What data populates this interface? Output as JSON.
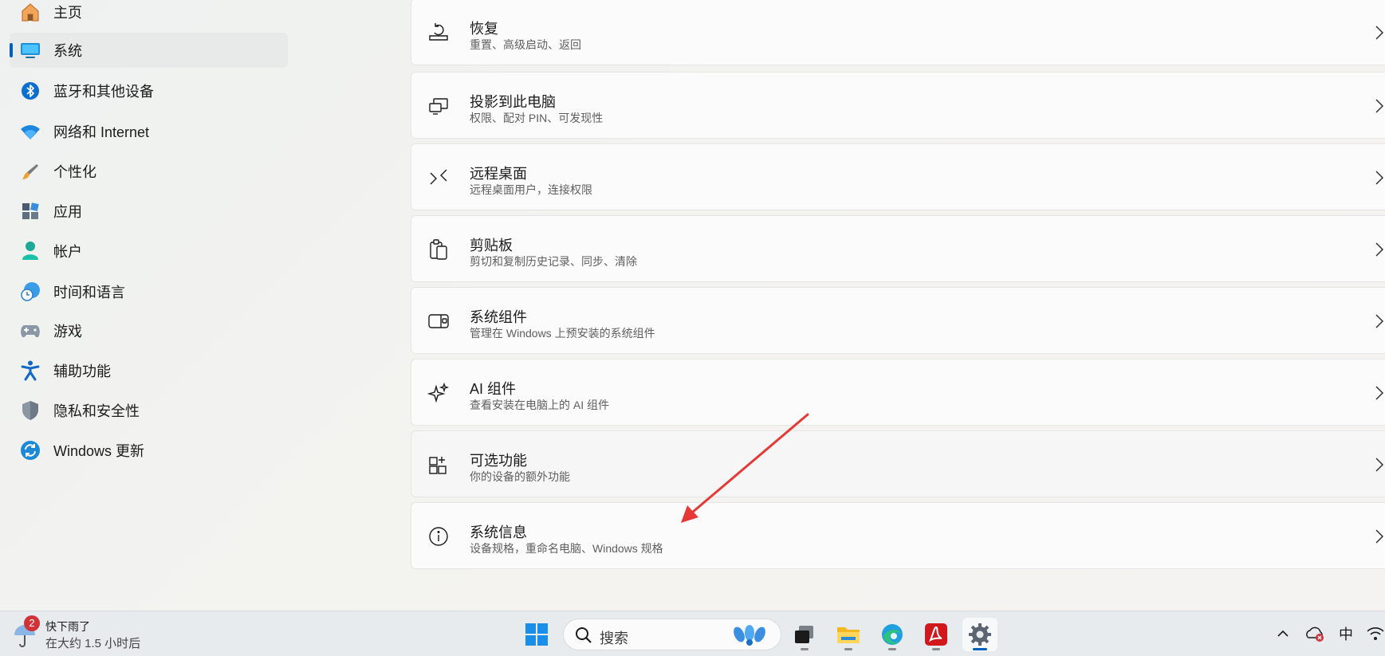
{
  "sidebar": {
    "items": [
      {
        "label": "主页",
        "icon": "home-icon"
      },
      {
        "label": "系统",
        "icon": "system-icon",
        "selected": true
      },
      {
        "label": "蓝牙和其他设备",
        "icon": "bluetooth-icon"
      },
      {
        "label": "网络和 Internet",
        "icon": "wifi-icon"
      },
      {
        "label": "个性化",
        "icon": "brush-icon"
      },
      {
        "label": "应用",
        "icon": "apps-icon"
      },
      {
        "label": "帐户",
        "icon": "account-icon"
      },
      {
        "label": "时间和语言",
        "icon": "globe-clock-icon"
      },
      {
        "label": "游戏",
        "icon": "gamepad-icon"
      },
      {
        "label": "辅助功能",
        "icon": "accessibility-icon"
      },
      {
        "label": "隐私和安全性",
        "icon": "shield-icon"
      },
      {
        "label": "Windows 更新",
        "icon": "update-icon"
      }
    ]
  },
  "settings": {
    "cards": [
      {
        "title": "恢复",
        "description": "重置、高级启动、返回",
        "icon": "recovery-icon"
      },
      {
        "title": "投影到此电脑",
        "description": "权限、配对 PIN、可发现性",
        "icon": "projection-icon"
      },
      {
        "title": "远程桌面",
        "description": "远程桌面用户，连接权限",
        "icon": "remote-desktop-icon"
      },
      {
        "title": "剪贴板",
        "description": "剪切和复制历史记录、同步、清除",
        "icon": "clipboard-icon"
      },
      {
        "title": "系统组件",
        "description": "管理在 Windows 上预安装的系统组件",
        "icon": "system-components-icon"
      },
      {
        "title": "AI 组件",
        "description": "查看安装在电脑上的 AI 组件",
        "icon": "sparkle-icon"
      },
      {
        "title": "可选功能",
        "description": "你的设备的额外功能",
        "icon": "optional-features-icon"
      },
      {
        "title": "系统信息",
        "description": "设备规格，重命名电脑、Windows 规格",
        "icon": "info-icon"
      }
    ]
  },
  "annotation": {
    "type": "red-arrow",
    "target": "系统信息",
    "color": "#e53935"
  },
  "taskbar": {
    "weather": {
      "title": "快下雨了",
      "subtitle": "在大约 1.5 小时后",
      "badge": "2"
    },
    "search": {
      "placeholder": "搜索"
    },
    "apps": [
      "start-icon",
      "task-view-icon",
      "file-explorer-icon",
      "edge-icon",
      "acrobat-icon",
      "settings-icon"
    ],
    "tray": {
      "ime": "中"
    }
  },
  "colors": {
    "accent": "#005fb8",
    "annotation": "#e53935"
  }
}
